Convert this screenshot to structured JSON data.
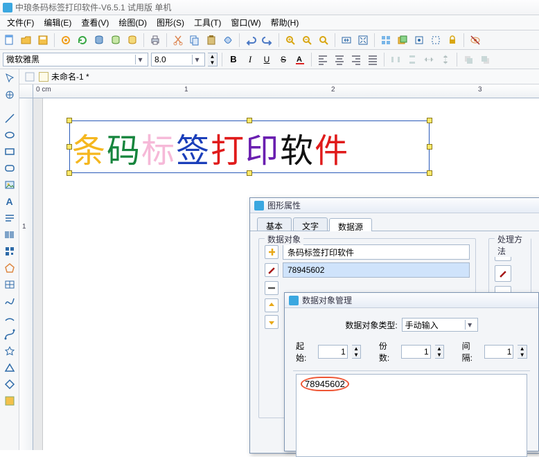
{
  "title": "中琅条码标签打印软件-V6.5.1 试用版 单机",
  "menu": [
    "文件(F)",
    "编辑(E)",
    "查看(V)",
    "绘图(D)",
    "图形(S)",
    "工具(T)",
    "窗口(W)",
    "帮助(H)"
  ],
  "font_name": "微软雅黑",
  "font_size": "8.0",
  "doc_tab": "未命名-1 *",
  "ruler_unit": "0 cm",
  "ruler_marks": [
    "1",
    "2",
    "3"
  ],
  "ruler_v": [
    "1"
  ],
  "big_text_chars": [
    {
      "c": "条",
      "color": "#f5b71f"
    },
    {
      "c": "码",
      "color": "#16853d"
    },
    {
      "c": "标",
      "color": "#f6b9d8"
    },
    {
      "c": "签",
      "color": "#1b3fba"
    },
    {
      "c": "打",
      "color": "#e01b1b"
    },
    {
      "c": "印",
      "color": "#6a1fb0"
    },
    {
      "c": "软",
      "color": "#111"
    },
    {
      "c": "件",
      "color": "#e01b1b"
    }
  ],
  "panel1": {
    "title": "图形属性",
    "tabs": [
      "基本",
      "文字",
      "数据源"
    ],
    "group_data": "数据对象",
    "group_method": "处理方法",
    "rows": [
      {
        "text": "条码标签打印软件",
        "sel": false
      },
      {
        "text": "78945602",
        "sel": true
      }
    ]
  },
  "panel2": {
    "title": "数据对象管理",
    "type_label": "数据对象类型:",
    "type_value": "手动输入",
    "start_label": "起始:",
    "start_value": "1",
    "count_label": "份数:",
    "count_value": "1",
    "gap_label": "间隔:",
    "gap_value": "1",
    "content": "78945602"
  }
}
